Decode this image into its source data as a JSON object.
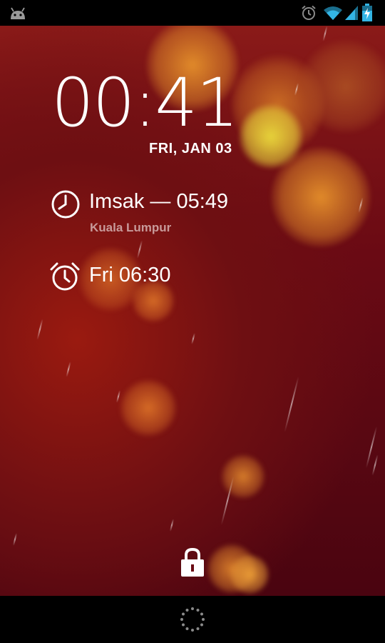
{
  "status_bar": {
    "left_icon": "android-icon",
    "right_icons": [
      "alarm-clock-icon",
      "wifi-icon",
      "signal-icon",
      "battery-charging-icon"
    ]
  },
  "lockscreen": {
    "time": "00:41",
    "date": "FRI, JAN 03",
    "prayer": {
      "icon": "clock-icon",
      "label": "Imsak — 05:49",
      "location": "Kuala Lumpur"
    },
    "alarm": {
      "icon": "alarm-clock-icon",
      "label": "Fri 06:30"
    },
    "unlock_icon": "lock-icon"
  },
  "nav_bar": {
    "icon": "loading-spinner-icon"
  },
  "colors": {
    "background_deep": "#4a0410",
    "background_warm": "#9a1a10",
    "bokeh_orange": "#e08a2a",
    "bokeh_yellow": "#e6d23a",
    "subtitle": "#c89a9a"
  }
}
